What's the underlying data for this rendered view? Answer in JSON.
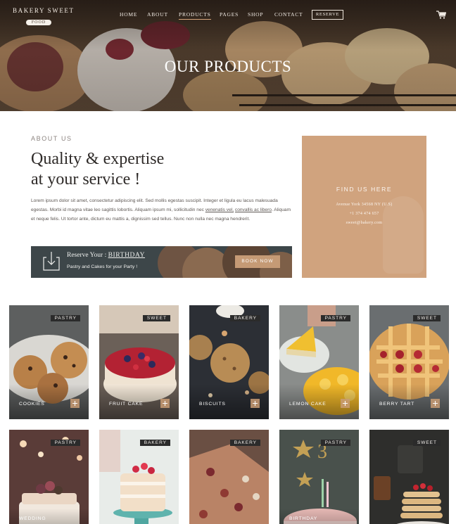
{
  "header": {
    "logo_top": "BAKERY SWEET",
    "logo_bottom": "FOOD",
    "nav": [
      "HOME",
      "ABOUT",
      "PRODUCTS",
      "PAGES",
      "SHOP",
      "CONTACT"
    ],
    "active_nav": "PRODUCTS",
    "reserve_label": "RESERVE",
    "cart_icon": "shopping-cart-icon"
  },
  "hero": {
    "title": "OUR PRODUCTS"
  },
  "about": {
    "kicker": "ABOUT US",
    "heading_line1": "Quality & expertise",
    "heading_line2": "at your service !",
    "text_part1": "Lorem ipsum dolor sit amet, consectetur adipiscing elit. Sed mollis egestas suscipit. Integer et ligula eu lacus malesuada egestas. Morbi id magna vitae leo sagittis lobortis. Aliquam ipsum mi, sollicitudin nec ",
    "link1": "venenatis vel,",
    "link2": "convallis ac libero",
    "text_part2": ". Aliquam et neque felis. Ut tortor ante, dictum eu mattis a, dignissim sed tellus. Nunc non nulla nec magna hendrerit."
  },
  "banner": {
    "line1_prefix": "Reserve Your : ",
    "line1_highlight": "BIRTHDAY",
    "line2": "Pastry and Cakes for your Party !",
    "button_label": "BOOK NOW",
    "icon": "download-box-icon"
  },
  "find_us": {
    "title": "FIND US HERE",
    "address": "Avenue York 34568 NY (U.S)",
    "phone": "+1 374 474 657",
    "email": "sweet@bakery.com"
  },
  "products": [
    {
      "name": "COOKIES",
      "tag": "PASTRY"
    },
    {
      "name": "FRUIT CAKE",
      "tag": "SWEET"
    },
    {
      "name": "BISCUITS",
      "tag": "BAKERY"
    },
    {
      "name": "LEMON CAKE",
      "tag": "PASTRY"
    },
    {
      "name": "BERRY TART",
      "tag": "SWEET"
    },
    {
      "name": "WEDDING",
      "tag": "PASTRY"
    },
    {
      "name": "",
      "tag": "BAKERY"
    },
    {
      "name": "",
      "tag": "BAKERY"
    },
    {
      "name": "BIRTHDAY",
      "tag": "PASTRY"
    },
    {
      "name": "",
      "tag": "SWEET"
    }
  ],
  "colors": {
    "accent": "#c99c74",
    "find_box": "#d0a37e",
    "tag_bg": "#2b2b2b",
    "banner_bg": "#3d4649"
  }
}
